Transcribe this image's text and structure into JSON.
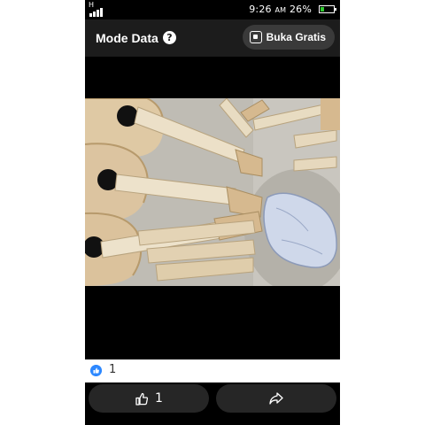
{
  "status_bar": {
    "network": "H",
    "time": "9:26",
    "ampm": "AM",
    "battery": "26%"
  },
  "header": {
    "title": "Mode Data",
    "help": "?",
    "open_free_label": "Buka Gratis"
  },
  "photo": {
    "subject": "ukulele-bodies-and-necks-workshop"
  },
  "reactions": {
    "like_count": "1"
  },
  "actions": {
    "like_count": "1"
  },
  "colors": {
    "header_bg": "#1c1c1c",
    "button_bg": "#262626",
    "like_blue": "#2d88ff",
    "wood": "#d8c3a0"
  }
}
